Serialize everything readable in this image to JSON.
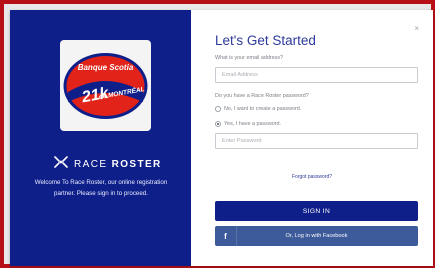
{
  "dialog": {
    "close_glyph": "×",
    "title": "Let's Get Started"
  },
  "left_panel": {
    "event_logo": {
      "sponsor_text": "Banque Scotia",
      "race_text": "21k",
      "race_sub": "de MONTRÉAL"
    },
    "brand": {
      "name_part1": "RACE",
      "name_part2": "ROSTER"
    },
    "welcome_text": "Welcome To Race Roster, our online registration partner. Please sign in to proceed."
  },
  "form": {
    "email_question": "What is your email address?",
    "email_placeholder": "Email Address",
    "email_value": "",
    "password_question": "Do you have a Race Roster password?",
    "radio_options": [
      {
        "label": "No, I want to create a password.",
        "checked": false
      },
      {
        "label": "Yes, I have a password.",
        "checked": true
      }
    ],
    "password_placeholder": "Enter Password",
    "password_value": "",
    "forgot_link": "Forgot password?",
    "signin_label": "SIGN IN",
    "facebook_icon": "f",
    "facebook_label": "Or, Log in with Facebook"
  },
  "colors": {
    "frame_red": "#b80f16",
    "brand_blue": "#0f1f8a",
    "facebook_blue": "#3d5a9b",
    "title_blue": "#2d3a9c"
  },
  "icons": {
    "close": "close-icon",
    "brand": "race-roster-logo-icon",
    "facebook": "facebook-icon"
  }
}
